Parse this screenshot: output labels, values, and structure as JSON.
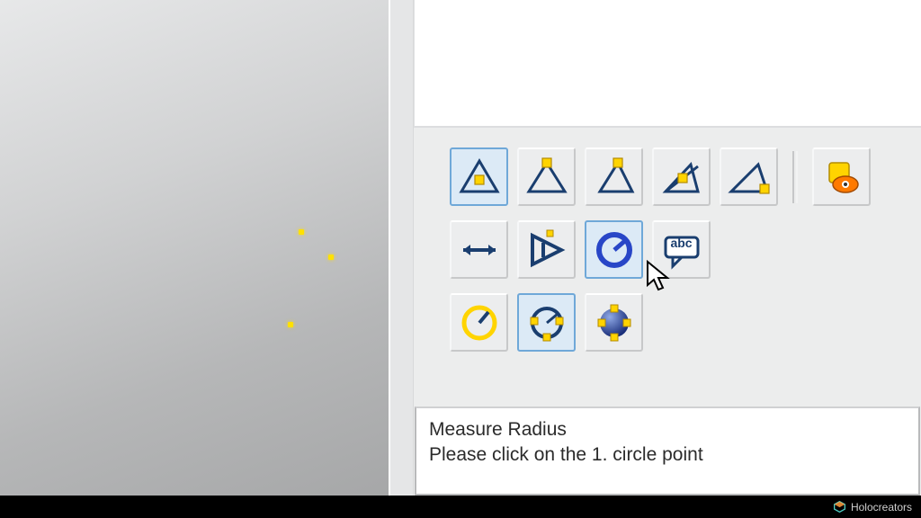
{
  "toolbar": {
    "row1": [
      {
        "name": "select-triangle-button",
        "icon": "triangle-point-in",
        "selected": true
      },
      {
        "name": "triangle-vertex-button",
        "icon": "triangle-vertex-up",
        "selected": false
      },
      {
        "name": "triangle-edge-button",
        "icon": "triangle-edge",
        "selected": false
      },
      {
        "name": "triangle-face-button",
        "icon": "triangle-face-dot",
        "selected": false
      },
      {
        "name": "triangle-slant-button",
        "icon": "triangle-slant",
        "selected": false
      }
    ],
    "row1_after_sep": [
      {
        "name": "visibility-toggle-button",
        "icon": "eye-square",
        "selected": false
      }
    ],
    "row2": [
      {
        "name": "measure-distance-button",
        "icon": "arrows-h",
        "selected": false
      },
      {
        "name": "measure-angle-button",
        "icon": "letter-a-tri",
        "selected": false
      },
      {
        "name": "measure-radius-button",
        "icon": "radius-circle",
        "selected": true
      },
      {
        "name": "annotation-label-button",
        "icon": "abc-bubble",
        "selected": false,
        "text": "abc"
      }
    ],
    "row3": [
      {
        "name": "clock-measure-button",
        "icon": "clock",
        "selected": false
      },
      {
        "name": "circle-points-button",
        "icon": "circle-nodes",
        "selected": true
      },
      {
        "name": "sphere-measure-button",
        "icon": "sphere-nodes",
        "selected": false
      }
    ]
  },
  "status": {
    "title": "Measure Radius",
    "hint": "Please click on the 1. circle point"
  },
  "watermark": "Holocreators"
}
